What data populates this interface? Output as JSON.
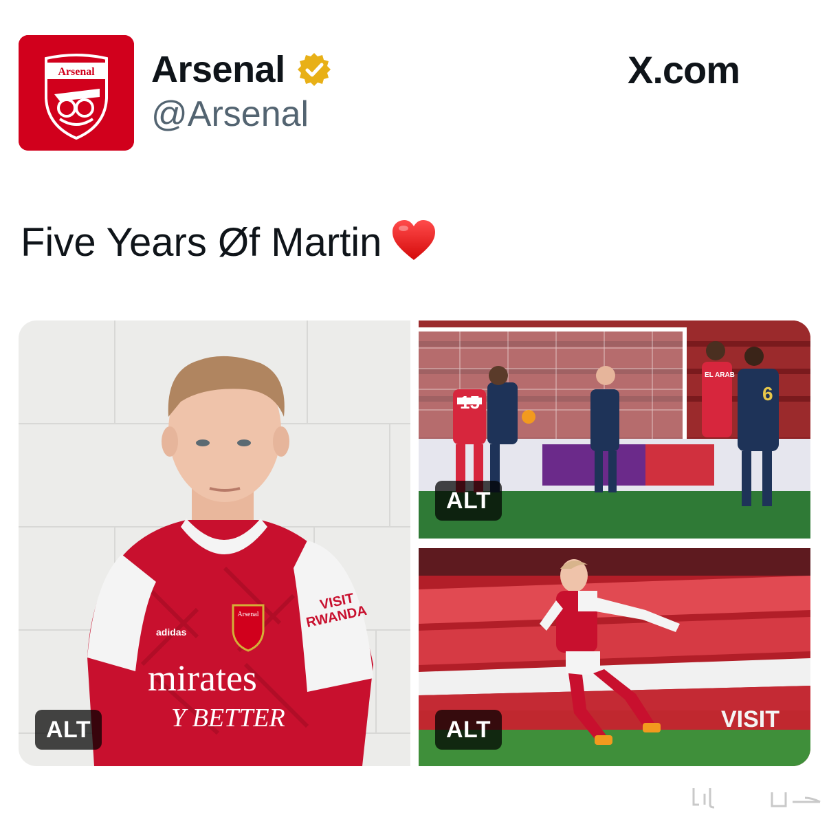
{
  "account": {
    "display_name": "Arsenal",
    "handle": "@Arsenal",
    "avatar_text": "Arsenal",
    "verified": true,
    "verified_badge_color": "#e8b017"
  },
  "source_label": "X.com",
  "tweet": {
    "text": "Five Years Øf Martin",
    "emoji": "heart-emoji"
  },
  "media": [
    {
      "badge": "ALT",
      "shirt_sponsor_text": "mirates",
      "shirt_slogan_text": "Y BETTER",
      "sleeve_text_1": "VISIT",
      "sleeve_text_2": "RWANDA",
      "kit_brand_text": "adidas",
      "crest_text": "Arsenal"
    },
    {
      "badge": "ALT",
      "shirt_number_1": "15",
      "shirt_number_2": "6",
      "name_tag": "EL ARAB"
    },
    {
      "badge": "ALT",
      "board_text": "VISIT"
    }
  ],
  "colors": {
    "arsenal_red": "#d1001c",
    "text_primary": "#0f1419",
    "text_secondary": "#536471"
  }
}
